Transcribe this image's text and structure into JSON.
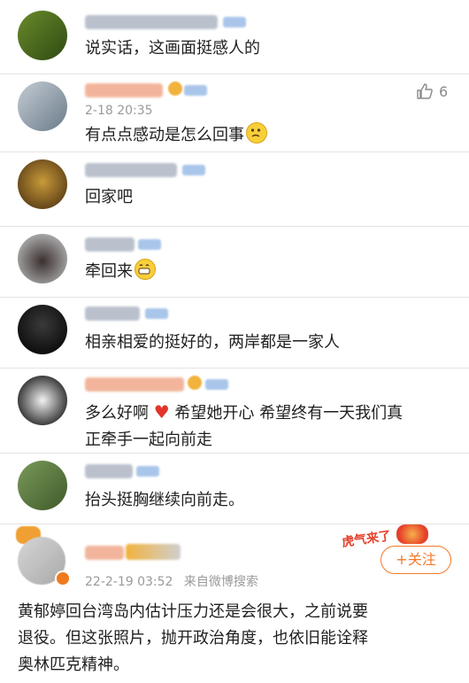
{
  "comments": [
    {
      "text": "说实话，这画面挺感人的"
    },
    {
      "text": "有点点感动是怎么回事",
      "time": "2-18 20:35",
      "likes": "6"
    },
    {
      "text": "回家吧"
    },
    {
      "text": "牵回来"
    },
    {
      "text": "相亲相爱的挺好的，两岸都是一家人"
    },
    {
      "text_line1": "多么好啊",
      "text_heart_after": "希望她开心 希望终有一天我们真",
      "text_line2": "正牵手一起向前走"
    },
    {
      "text": "抬头挺胸继续向前走。"
    }
  ],
  "post": {
    "time": "22-2-19 03:52",
    "source": "来自微博搜索",
    "follow_label": "+关注",
    "stamp": "虎气来了",
    "body": [
      "黄郁婷回台湾岛内估计压力还是会很大，之前说要",
      "退役。但这张照片，抛开政治角度，也依旧能诠释",
      "奥林匹克精神。"
    ]
  },
  "colors": {
    "name_blurred": "#9fb6d6",
    "name_orange": "#f0a98a",
    "meta": "#9a9a9a",
    "follow": "#f47a2a",
    "heart": "#e0342c"
  }
}
